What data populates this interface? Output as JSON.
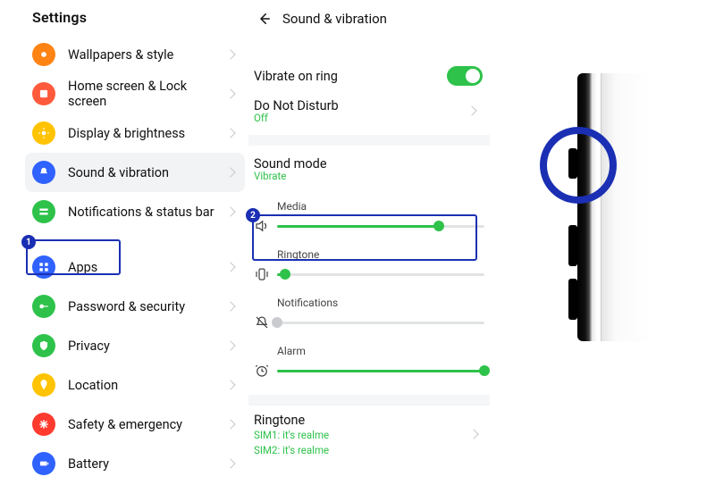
{
  "settings": {
    "title": "Settings",
    "items": [
      {
        "label": "Wallpapers & style",
        "icon": "wallpaper",
        "color": "#ff8414"
      },
      {
        "label": "Home screen & Lock screen",
        "icon": "home",
        "color": "#ff5a3c"
      },
      {
        "label": "Display & brightness",
        "icon": "sun",
        "color": "#ffc300"
      },
      {
        "label": "Sound & vibration",
        "icon": "bell",
        "color": "#2f62ff",
        "active": true
      },
      {
        "label": "Notifications & status bar",
        "icon": "notif",
        "color": "#2ec24a"
      },
      {
        "label": "Apps",
        "icon": "apps",
        "color": "#2f62ff"
      },
      {
        "label": "Password & security",
        "icon": "key",
        "color": "#2ec24a"
      },
      {
        "label": "Privacy",
        "icon": "shield",
        "color": "#2ec24a"
      },
      {
        "label": "Location",
        "icon": "pin",
        "color": "#ffc300"
      },
      {
        "label": "Safety & emergency",
        "icon": "asterisk",
        "color": "#ff3b30"
      },
      {
        "label": "Battery",
        "icon": "battery",
        "color": "#2f62ff"
      }
    ]
  },
  "sound": {
    "title": "Sound & vibration",
    "vibrate_on_ring": {
      "label": "Vibrate on ring",
      "on": true
    },
    "dnd": {
      "label": "Do Not Disturb",
      "status": "Off"
    },
    "sound_mode": {
      "label": "Sound mode",
      "value": "Vibrate"
    },
    "sliders": {
      "media": {
        "label": "Media",
        "pct": 78
      },
      "ringtone": {
        "label": "Ringtone",
        "pct": 4
      },
      "notifications": {
        "label": "Notifications",
        "pct": 0
      },
      "alarm": {
        "label": "Alarm",
        "pct": 100
      }
    },
    "ringtone": {
      "label": "Ringtone",
      "sim1": "SIM1: it's realme",
      "sim2": "SIM2: it's realme"
    }
  },
  "annotations": {
    "badge1": "1",
    "badge2": "2"
  },
  "colors": {
    "accent": "#2ec24a",
    "badge": "#1a2fb3"
  }
}
